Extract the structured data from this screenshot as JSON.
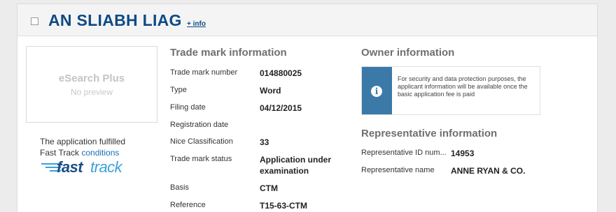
{
  "header": {
    "title": "AN SLIABH LIAG",
    "info_link": "+ info"
  },
  "preview": {
    "title": "eSearch Plus",
    "subtitle": "No preview"
  },
  "fast_track": {
    "text_line1": "The application fulfilled",
    "text_line2": "Fast Track",
    "conditions_link": "conditions",
    "logo_word_a": "fast",
    "logo_word_b": "track",
    "logo_colors": {
      "dark": "#1a4d8a",
      "light": "#3aa1d8"
    }
  },
  "trade_mark": {
    "heading": "Trade mark information",
    "rows": [
      {
        "label": "Trade mark number",
        "value": "014880025"
      },
      {
        "label": "Type",
        "value": "Word"
      },
      {
        "label": "Filing date",
        "value": "04/12/2015"
      },
      {
        "label": "Registration date",
        "value": ""
      },
      {
        "label": "Nice Classification",
        "value": "33"
      },
      {
        "label": "Trade mark status",
        "value": "Application under examination"
      },
      {
        "label": "Basis",
        "value": "CTM"
      },
      {
        "label": "Reference",
        "value": "T15-63-CTM"
      }
    ]
  },
  "owner": {
    "heading": "Owner information",
    "notice_icon": "info-icon",
    "notice_text": "For security and data protection purposes, the applicant information will be available once the basic application fee is paid"
  },
  "representative": {
    "heading": "Representative information",
    "rows": [
      {
        "label": "Representative ID num...",
        "value": "14953"
      },
      {
        "label": "Representative name",
        "value": "ANNE RYAN & CO."
      }
    ]
  },
  "colors": {
    "title": "#0f4a84",
    "section_heading": "#6f6f6f",
    "notice_bar": "#3b79a8"
  }
}
